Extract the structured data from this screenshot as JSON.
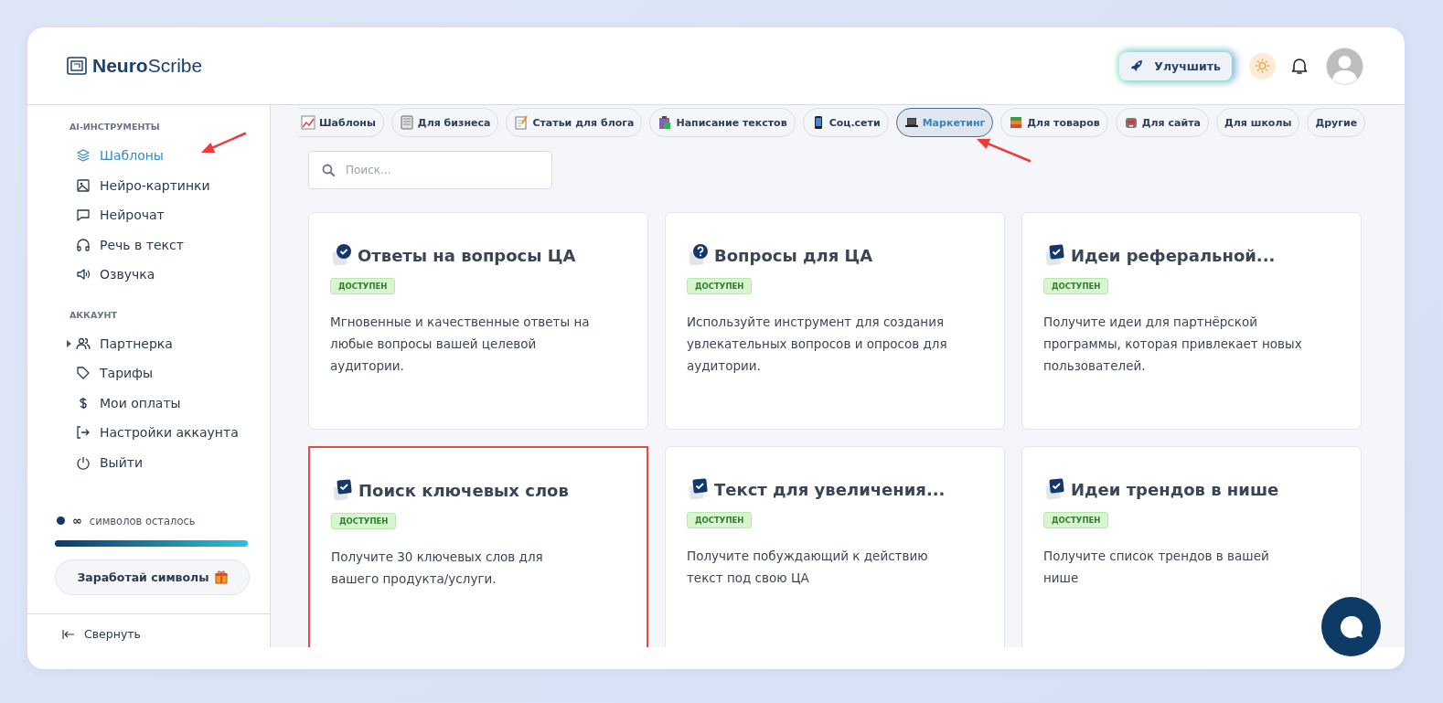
{
  "header": {
    "logo": {
      "brand_bold": "Neuro",
      "brand_light": "Scribe"
    },
    "upgrade_button": "Улучшить"
  },
  "sidebar": {
    "sections": [
      {
        "title": "AI-ИНСТРУМЕНТЫ",
        "items": [
          {
            "label": "Шаблоны",
            "selected": true,
            "annotated": true,
            "expandable": false
          },
          {
            "label": "Нейро-картинки",
            "selected": false,
            "annotated": false,
            "expandable": false
          },
          {
            "label": "Нейрочат",
            "selected": false,
            "annotated": false,
            "expandable": false
          },
          {
            "label": "Речь в текст",
            "selected": false,
            "annotated": false,
            "expandable": false
          },
          {
            "label": "Озвучка",
            "selected": false,
            "annotated": false,
            "expandable": false
          }
        ]
      },
      {
        "title": "АККАУНТ",
        "items": [
          {
            "label": "Партнерка",
            "selected": false,
            "annotated": false,
            "expandable": true
          },
          {
            "label": "Тарифы",
            "selected": false,
            "annotated": false,
            "expandable": false
          },
          {
            "label": "Мои оплаты",
            "selected": false,
            "annotated": false,
            "expandable": false
          },
          {
            "label": "Настройки аккаунта",
            "selected": false,
            "annotated": false,
            "expandable": false
          },
          {
            "label": "Выйти",
            "selected": false,
            "annotated": false,
            "expandable": false
          }
        ]
      }
    ],
    "credits": {
      "amount": "∞",
      "text": "символов осталось",
      "level": 1
    },
    "earn_button": "Заработай символы",
    "collapse": "Свернуть"
  },
  "tabs": [
    {
      "label": "Шаблоны",
      "selected": false,
      "annotated": false
    },
    {
      "label": "Для бизнеса",
      "selected": false,
      "annotated": false
    },
    {
      "label": "Статьи для блога",
      "selected": false,
      "annotated": false
    },
    {
      "label": "Написание текстов",
      "selected": false,
      "annotated": false
    },
    {
      "label": "Соц.сети",
      "selected": false,
      "annotated": false
    },
    {
      "label": "Маркетинг",
      "selected": true,
      "annotated": true
    },
    {
      "label": "Для товаров",
      "selected": false,
      "annotated": false
    },
    {
      "label": "Для сайта",
      "selected": false,
      "annotated": false
    },
    {
      "label": "Для школы",
      "selected": false,
      "annotated": false
    },
    {
      "label": "Другие",
      "selected": false,
      "annotated": false
    }
  ],
  "search": {
    "placeholder": "Поиск..."
  },
  "cards": [
    {
      "title": "Ответы на вопросы ЦА",
      "kind": "answer",
      "badge": "ДОСТУПЕН",
      "description": "Мгновенные и качественные ответы на любые вопросы вашей целевой аудитории.",
      "highlighted": false
    },
    {
      "title": "Вопросы для ЦА",
      "kind": "question",
      "badge": "ДОСТУПЕН",
      "description": "Используйте инструмент для создания увлекательных вопросов и опросов для аудитории.",
      "highlighted": false
    },
    {
      "title": "Идеи реферальной...",
      "kind": "task",
      "badge": "ДОСТУПЕН",
      "description": "Получите идеи для партнёрской программы, которая привлекает новых пользователей.",
      "highlighted": false
    },
    {
      "title": "Поиск ключевых слов",
      "kind": "task",
      "badge": "ДОСТУПЕН",
      "description": "Получите 30 ключевых слов для вашего продукта/услуги.",
      "highlighted": true
    },
    {
      "title": "Текст для увеличения...",
      "kind": "task",
      "badge": "ДОСТУПЕН",
      "description": "Получите побуждающий к действию текст под свою ЦА",
      "highlighted": false
    },
    {
      "title": "Идеи трендов в нише",
      "kind": "task",
      "badge": "ДОСТУПЕН",
      "description": "Получите список трендов в вашей нише",
      "highlighted": false
    }
  ]
}
